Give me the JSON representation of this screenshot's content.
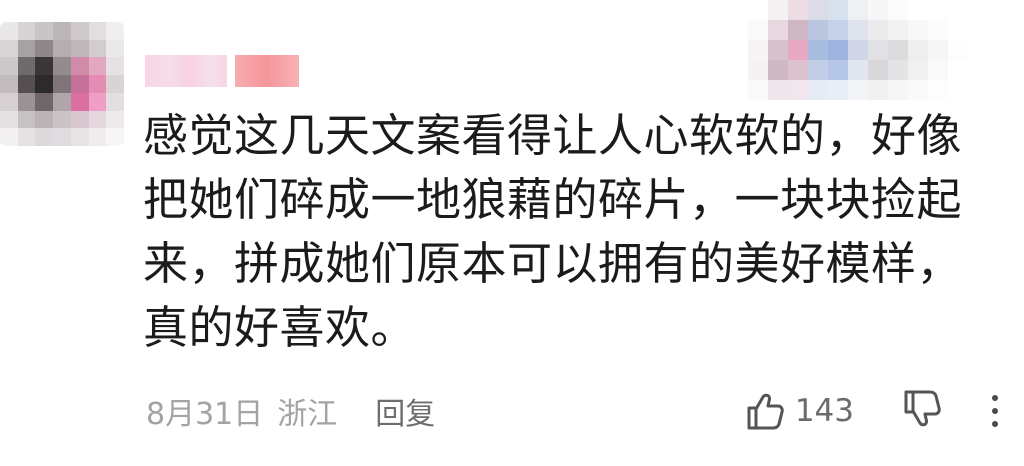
{
  "comment": {
    "avatar_icon": "avatar-pixelated",
    "text": "感觉这几天文案看得让人心软软的，好像把她们碎成一地狼藉的碎片，一块块捡起来，拼成她们原本可以拥有的美好模样，真的好喜欢。",
    "date": "8月31日",
    "location": "浙江",
    "reply_label": "回复",
    "like_count": "143",
    "like_icon": "thumbs-up-icon",
    "dislike_icon": "thumbs-down-icon",
    "more_icon": "more-vertical-icon"
  }
}
